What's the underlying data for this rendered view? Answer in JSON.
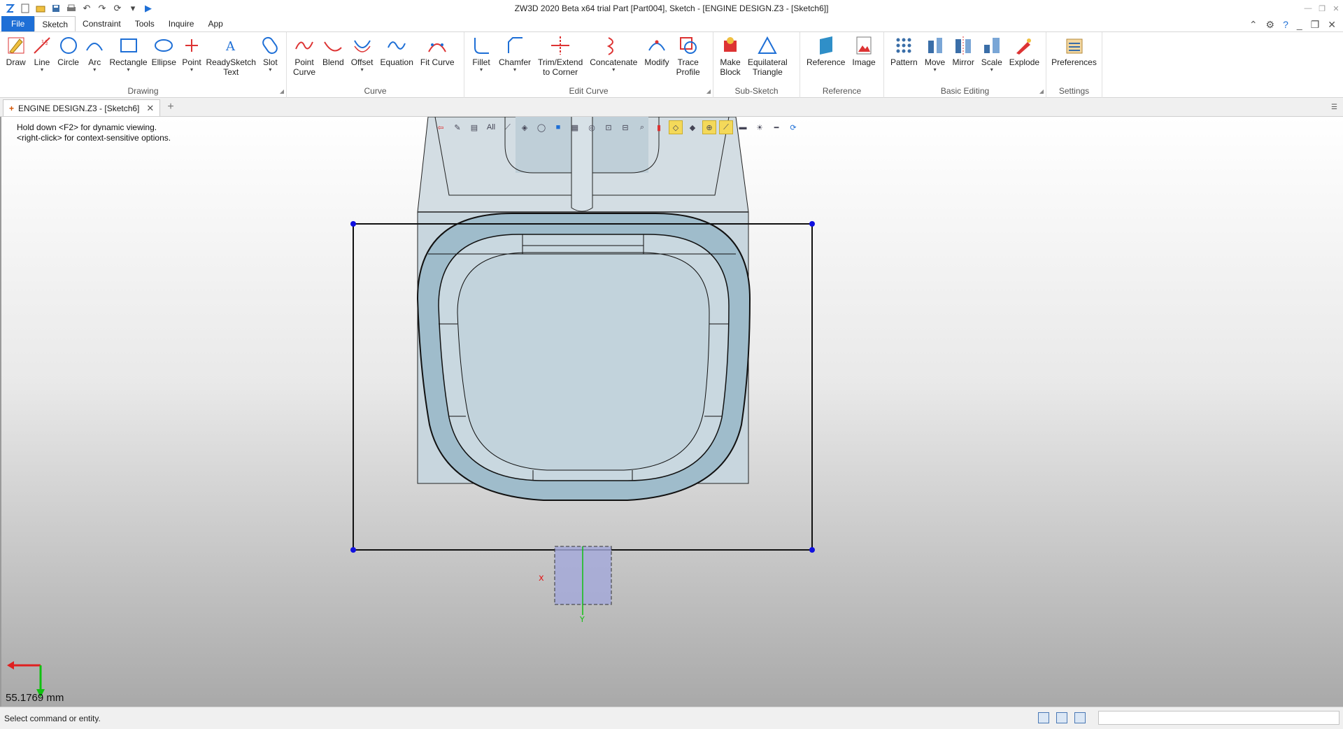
{
  "title": "ZW3D 2020 Beta x64 trial        Part [Part004],  Sketch - [ENGINE DESIGN.Z3 - [Sketch6]]",
  "menu_tabs": [
    "File",
    "Sketch",
    "Constraint",
    "Tools",
    "Inquire",
    "App"
  ],
  "active_tab": "Sketch",
  "ribbon": {
    "drawing": {
      "label": "Drawing",
      "tools": [
        "Draw",
        "Line",
        "Circle",
        "Arc",
        "Rectangle",
        "Ellipse",
        "Point",
        "ReadySketch\nText",
        "Slot"
      ]
    },
    "curve": {
      "label": "Curve",
      "tools": [
        "Point\nCurve",
        "Blend",
        "Offset",
        "Equation",
        "Fit Curve"
      ]
    },
    "edit_curve": {
      "label": "Edit Curve",
      "tools": [
        "Fillet",
        "Chamfer",
        "Trim/Extend\nto Corner",
        "Concatenate",
        "Modify",
        "Trace\nProfile"
      ]
    },
    "sub_sketch": {
      "label": "Sub-Sketch",
      "tools": [
        "Make\nBlock",
        "Equilateral\nTriangle"
      ]
    },
    "reference": {
      "label": "Reference",
      "tools": [
        "Reference",
        "Image"
      ]
    },
    "basic_editing": {
      "label": "Basic Editing",
      "tools": [
        "Pattern",
        "Move",
        "Mirror",
        "Scale",
        "Explode"
      ]
    },
    "settings": {
      "label": "Settings",
      "tools": [
        "Preferences"
      ]
    }
  },
  "document_tab": "ENGINE DESIGN.Z3 - [Sketch6]",
  "viewport": {
    "hint_line1": "Hold down <F2> for dynamic viewing.",
    "hint_line2": "<right-click> for context-sensitive options.",
    "filter_label": "All",
    "dimension_readout": "55.1769 mm"
  },
  "status": {
    "message": "Select command or entity.",
    "command_input": ""
  },
  "colors": {
    "file_tab": "#1e6fd6",
    "part_fill": "#9fbccb",
    "handle": "#1010e0",
    "axis_x": "#e02020",
    "axis_y": "#10c010"
  }
}
